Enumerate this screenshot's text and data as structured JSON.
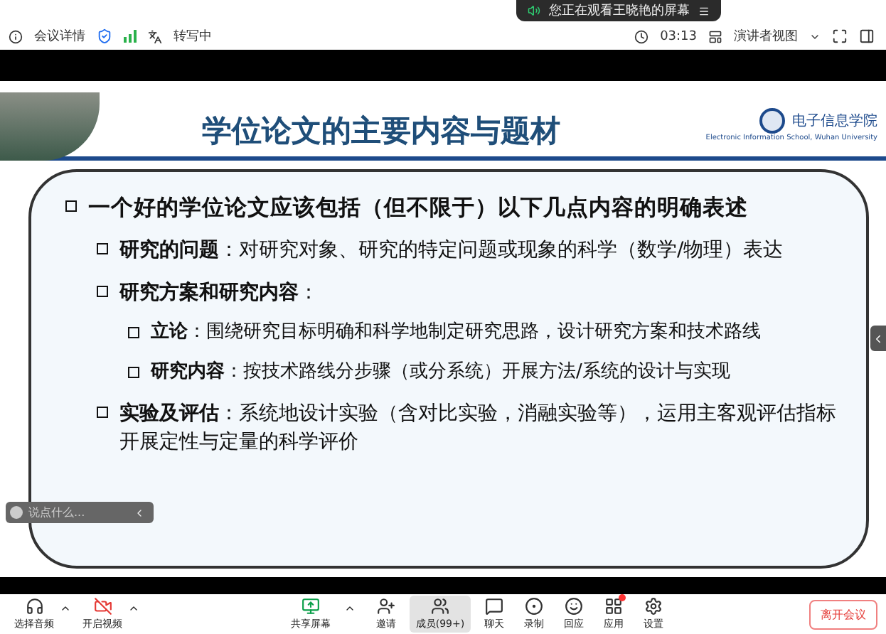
{
  "banner": {
    "text": "您正在观看王晓艳的屏幕"
  },
  "top_bar": {
    "meeting_info": "会议详情",
    "transcribing": "转写中",
    "timer": "03:13",
    "view_mode": "演讲者视图"
  },
  "slide": {
    "title": "学位论文的主要内容与题材",
    "school_name": "电子信息学院",
    "school_name_en": "Electronic Information School, Wuhan University",
    "bullets": [
      {
        "text": "一个好的学位论文应该包括（但不限于）以下几点内容的明确表述",
        "children": [
          {
            "text": "**研究的问题**：对研究对象、研究的特定问题或现象的科学（数学/物理）表达"
          },
          {
            "text": "**研究方案和研究内容**：",
            "children": [
              {
                "text": "**立论**：围绕研究目标明确和科学地制定研究思路，设计研究方案和技术路线"
              },
              {
                "text": "**研究内容**：按技术路线分步骤（或分系统）开展方法/系统的设计与实现"
              }
            ]
          },
          {
            "text": "**实验及评估**：系统地设计实验（含对比实验，消融实验等），运用主客观评估指标开展定性与定量的科学评价"
          }
        ]
      }
    ]
  },
  "chat_input": {
    "placeholder": "说点什么..."
  },
  "toolbar": [
    {
      "kind": "audio",
      "label": "选择音频",
      "selected": false
    },
    {
      "kind": "video",
      "label": "开启视频",
      "selected": false
    },
    {
      "kind": "share",
      "label": "共享屏幕",
      "selected": false
    },
    {
      "kind": "invite",
      "label": "邀请",
      "selected": false
    },
    {
      "kind": "members",
      "label": "成员(99+)",
      "selected": true
    },
    {
      "kind": "chat",
      "label": "聊天",
      "selected": false
    },
    {
      "kind": "record",
      "label": "录制",
      "selected": false
    },
    {
      "kind": "react",
      "label": "回应",
      "selected": false
    },
    {
      "kind": "apps",
      "label": "应用",
      "selected": false
    },
    {
      "kind": "settings",
      "label": "设置",
      "selected": false
    }
  ],
  "leave_button": "离开会议"
}
